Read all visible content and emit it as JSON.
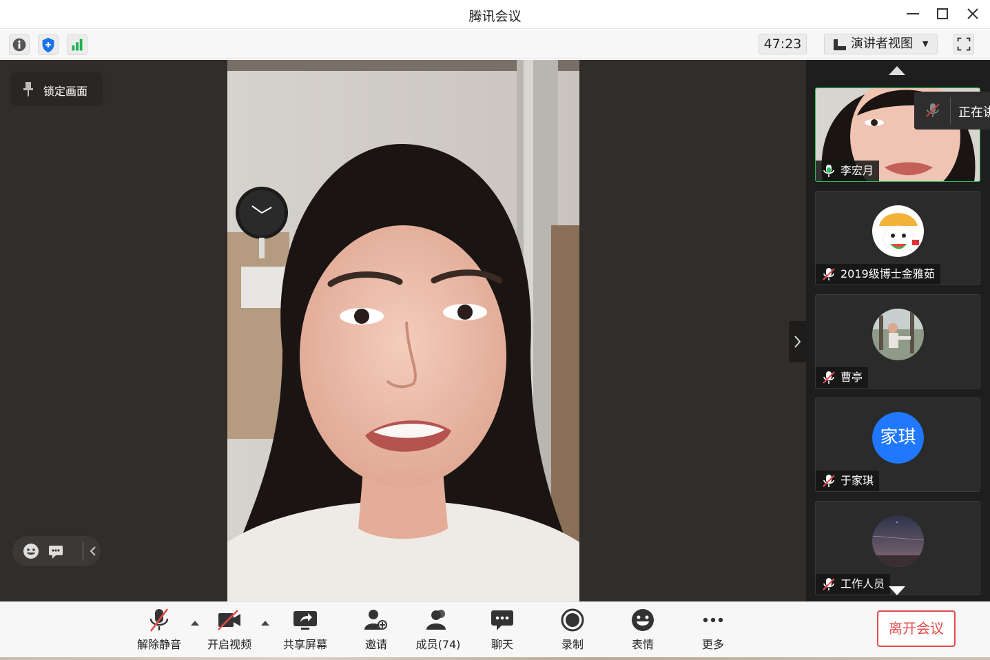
{
  "window": {
    "title": "腾讯会议"
  },
  "toolbar": {
    "timer": "47:23",
    "view_mode": "演讲者视图"
  },
  "main": {
    "lock_label": "锁定画面"
  },
  "speaking_popup": {
    "text": "正在讲"
  },
  "participants": [
    {
      "name": "李宏月",
      "mic": "active",
      "active_speaker": true
    },
    {
      "name": "2019级博士金雅茹",
      "mic": "muted"
    },
    {
      "name": "曹亭",
      "mic": "muted"
    },
    {
      "name": "于家琪",
      "mic": "muted",
      "avatar_text": "家琪",
      "avatar_color": "#1f78ff"
    },
    {
      "name": "工作人员",
      "mic": "muted"
    }
  ],
  "bottombar": {
    "unmute": "解除静音",
    "start_video": "开启视频",
    "share_screen": "共享屏幕",
    "invite": "邀请",
    "members": "成员(74)",
    "chat": "聊天",
    "record": "录制",
    "emoji": "表情",
    "more": "更多",
    "leave": "离开会议"
  },
  "colors": {
    "accent_red": "#e44b4b",
    "active_green": "#27c05a",
    "avatar_blue": "#1f78ff",
    "stage_bg": "#312d2a"
  }
}
